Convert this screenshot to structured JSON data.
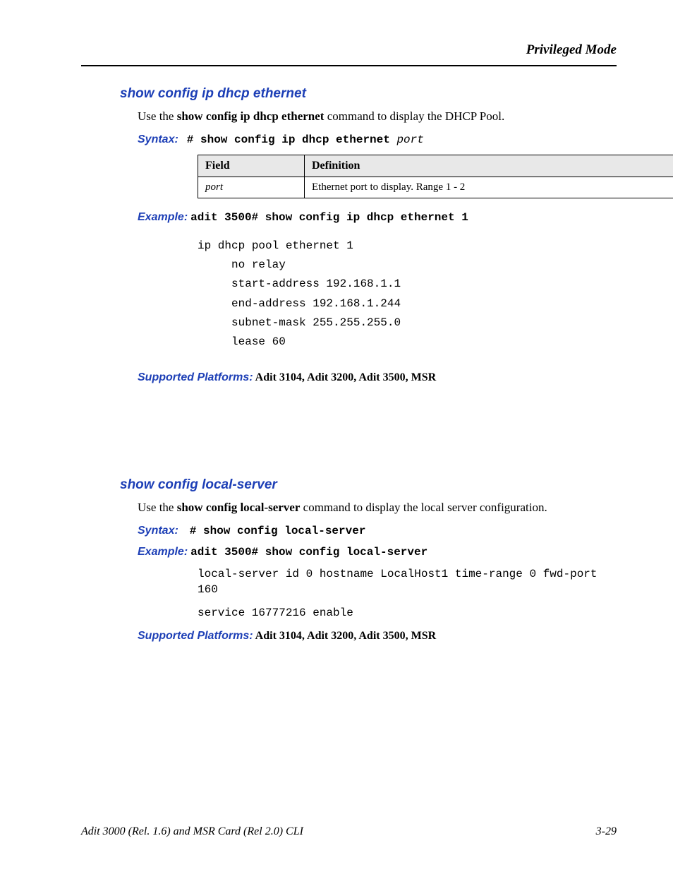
{
  "header": {
    "mode": "Privileged Mode"
  },
  "section1": {
    "title": "show config ip dhcp ethernet",
    "intro_pre": "Use the ",
    "intro_cmd": "show config ip dhcp ethernet",
    "intro_post": " command to display the DHCP Pool.",
    "syntax_label": "Syntax:",
    "syntax_hash": "# ",
    "syntax_cmd": "show config ip dhcp ethernet ",
    "syntax_arg": "port",
    "table": {
      "h1": "Field",
      "h2": "Definition",
      "r1c1": "port",
      "r1c2": "Ethernet port to display. Range 1 - 2"
    },
    "example_label": "Example:",
    "example_cmd": "adit 3500# show config ip dhcp ethernet 1",
    "code": "ip dhcp pool ethernet 1\n     no relay\n     start-address 192.168.1.1\n     end-address 192.168.1.244\n     subnet-mask 255.255.255.0\n     lease 60",
    "platforms_label": "Supported Platforms:",
    "platforms": "  Adit 3104, Adit 3200, Adit 3500, MSR"
  },
  "section2": {
    "title": "show config local-server",
    "intro_pre": "Use the ",
    "intro_cmd": "show config local-server",
    "intro_post": " command to display the local server configuration.",
    "syntax_label": "Syntax:",
    "syntax_hash": "# ",
    "syntax_cmd": "show config local-server",
    "example_label": "Example:",
    "example_cmd": "adit 3500# show config local-server",
    "output1": "local-server id 0 hostname LocalHost1 time-range 0 fwd-port 160",
    "output2": "service 16777216  enable",
    "platforms_label": "Supported Platforms:",
    "platforms": "  Adit 3104, Adit 3200, Adit 3500, MSR"
  },
  "footer": {
    "left": "Adit 3000 (Rel. 1.6) and MSR Card (Rel 2.0) CLI",
    "right": "3-29"
  }
}
